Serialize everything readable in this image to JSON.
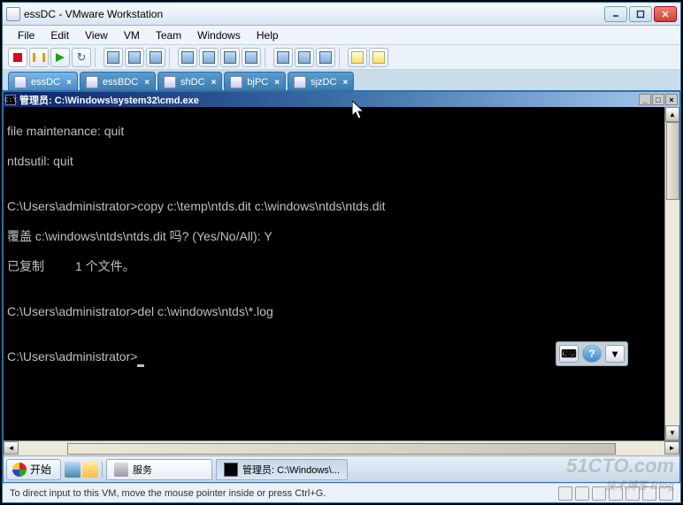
{
  "window": {
    "title": "essDC - VMware Workstation",
    "menus": [
      "File",
      "Edit",
      "View",
      "VM",
      "Team",
      "Windows",
      "Help"
    ]
  },
  "tabs": [
    {
      "label": "essDC",
      "active": true
    },
    {
      "label": "essBDC",
      "active": false
    },
    {
      "label": "shDC",
      "active": false
    },
    {
      "label": "bjPC",
      "active": false
    },
    {
      "label": "sjzDC",
      "active": false
    }
  ],
  "guest": {
    "cmd_title_prefix": "管理员: ",
    "cmd_title_path": "C:\\Windows\\system32\\cmd.exe",
    "terminal_lines": [
      "file maintenance: quit",
      "ntdsutil: quit",
      "",
      "C:\\Users\\administrator>copy c:\\temp\\ntds.dit c:\\windows\\ntds\\ntds.dit",
      "覆盖 c:\\windows\\ntds\\ntds.dit 吗? (Yes/No/All): Y",
      "已复制         1 个文件。",
      "",
      "C:\\Users\\administrator>del c:\\windows\\ntds\\*.log",
      "",
      "C:\\Users\\administrator>"
    ],
    "start_label": "开始",
    "taskbar_items": [
      {
        "label": "服务",
        "active": false,
        "icon": "services-icon"
      },
      {
        "label": "管理员: C:\\Windows\\...",
        "active": true,
        "icon": "cmd-icon"
      }
    ]
  },
  "statusbar": {
    "hint": "To direct input to this VM, move the mouse pointer inside or press Ctrl+G."
  },
  "watermark": {
    "main": "51CTO.com",
    "sub": "技术博客  Blog"
  }
}
